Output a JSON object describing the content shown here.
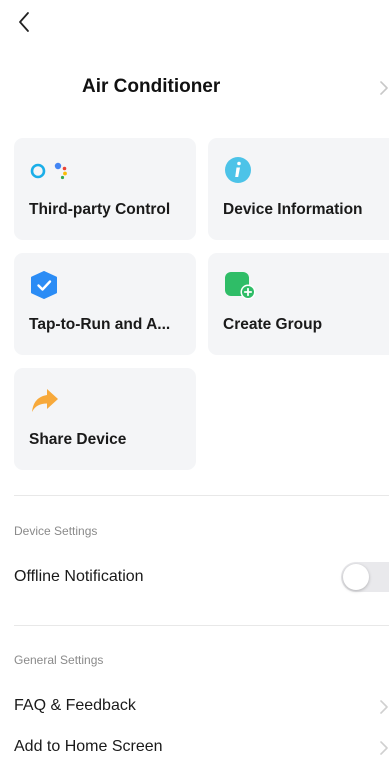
{
  "header": {
    "title": "Air Conditioner"
  },
  "cards": [
    {
      "label": "Third-party Control",
      "icon": "alexa-google-assistant-icon"
    },
    {
      "label": "Device Information",
      "icon": "info-icon"
    },
    {
      "label": "Tap-to-Run and A...",
      "icon": "automation-icon"
    },
    {
      "label": "Create Group",
      "icon": "create-group-icon"
    },
    {
      "label": "Share Device",
      "icon": "share-arrow-icon"
    }
  ],
  "device_settings": {
    "header": "Device Settings",
    "offline_notification": {
      "label": "Offline Notification",
      "enabled": false
    }
  },
  "general_settings": {
    "header": "General Settings",
    "items": [
      {
        "label": "FAQ & Feedback"
      },
      {
        "label": "Add to Home Screen"
      }
    ]
  },
  "colors": {
    "card_background": "#f4f5f7",
    "info_blue": "#4cc3e8",
    "automation_blue": "#2b8cf5",
    "group_green": "#2fbd67",
    "share_orange": "#f7a93b",
    "toggle_off": "#e9e9ec"
  }
}
